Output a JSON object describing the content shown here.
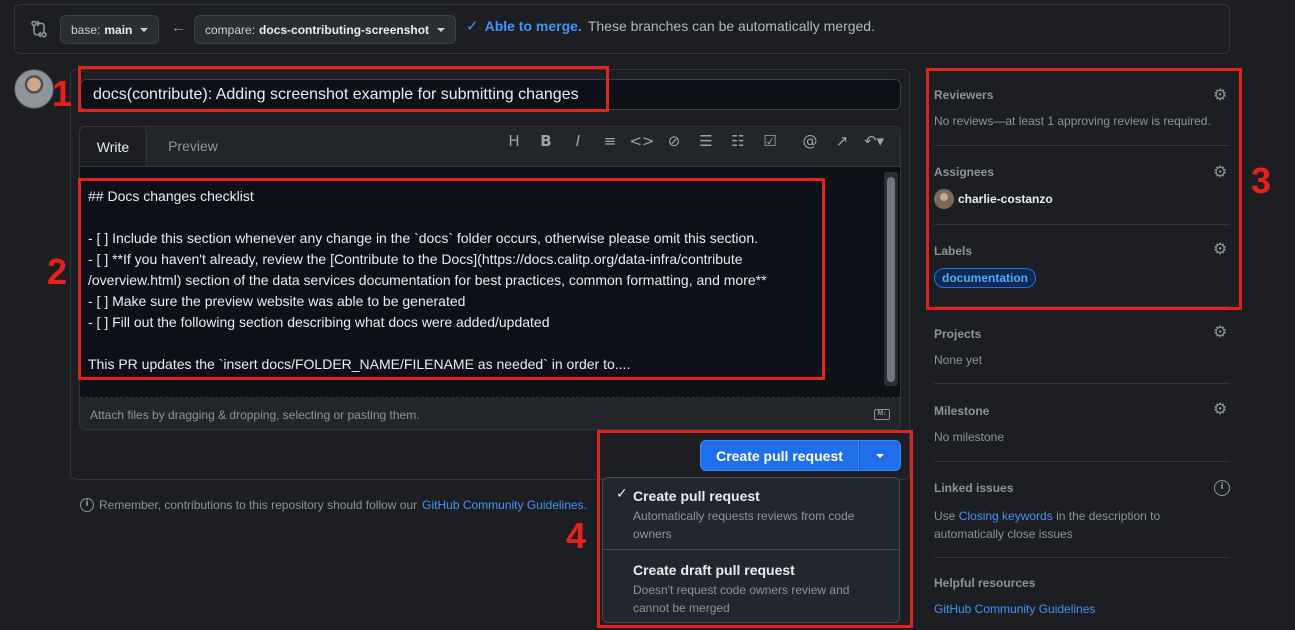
{
  "compare_bar": {
    "base_prefix": "base:",
    "base_branch": "main",
    "compare_prefix": "compare:",
    "compare_branch": "docs-contributing-screenshot",
    "merge_ok": "Able to merge.",
    "merge_msg": "These branches can be automatically merged."
  },
  "annotations": [
    "1",
    "2",
    "3",
    "4"
  ],
  "pr": {
    "title": "docs(contribute): Adding screenshot example for submitting changes",
    "tabs": [
      "Write",
      "Preview"
    ],
    "toolbar_icons": [
      "heading-icon",
      "bold-icon",
      "italic-icon",
      "quote-icon",
      "code-icon",
      "link-icon",
      "unordered-list-icon",
      "ordered-list-icon",
      "task-list-icon",
      "mention-icon",
      "reference-icon",
      "undo-icon"
    ],
    "body": "## Docs changes checklist\n\n- [ ] Include this section whenever any change in the `docs` folder occurs, otherwise please omit this section.\n- [ ] **If you haven't already, review the [Contribute to the Docs](https://docs.calitp.org/data-infra/contribute\n/overview.html) section of the data services documentation for best practices, common formatting, and more**\n- [ ] Make sure the preview website was able to be generated\n- [ ] Fill out the following section describing what docs were added/updated\n\nThis PR updates the `insert docs/FOLDER_NAME/FILENAME as needed` in order to....",
    "attach_hint": "Attach files by dragging & dropping, selecting or pasting them.",
    "md_badge": "M↓"
  },
  "actions": {
    "create_label": "Create pull request",
    "dropdown": [
      {
        "title": "Create pull request",
        "desc": "Automatically requests reviews from code owners",
        "selected": true
      },
      {
        "title": "Create draft pull request",
        "desc": "Doesn't request code owners review and cannot be merged",
        "selected": false
      }
    ]
  },
  "notice": {
    "text": "Remember, contributions to this repository should follow our",
    "link": "GitHub Community Guidelines."
  },
  "sidebar": {
    "reviewers": {
      "heading": "Reviewers",
      "text": "No reviews—at least 1 approving review is required."
    },
    "assignees": {
      "heading": "Assignees",
      "user": "charlie-costanzo"
    },
    "labels": {
      "heading": "Labels",
      "label": "documentation"
    },
    "projects": {
      "heading": "Projects",
      "text": "None yet"
    },
    "milestone": {
      "heading": "Milestone",
      "text": "No milestone"
    },
    "linked_issues": {
      "heading": "Linked issues",
      "pre": "Use",
      "link": "Closing keywords",
      "post": "in the description to automatically close issues"
    },
    "helpful": {
      "heading": "Helpful resources",
      "link": "GitHub Community Guidelines"
    }
  },
  "colors": {
    "accent": "#1f6feb",
    "annotation": "#e8201a",
    "background": "#1c1e22"
  }
}
